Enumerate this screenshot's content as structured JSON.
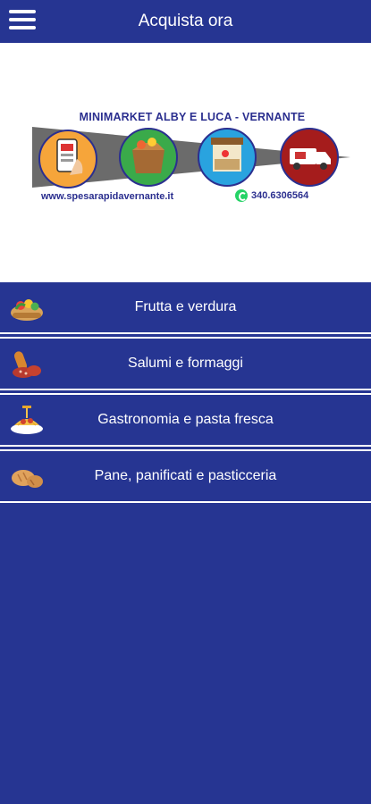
{
  "header": {
    "title": "Acquista ora",
    "menu_icon": "hamburger-menu-icon"
  },
  "banner": {
    "title": "MINIMARKET ALBY E LUCA - VERNANTE",
    "url": "www.spesarapidavernante.it",
    "phone": "340.6306564",
    "icons": [
      "phone-order-icon",
      "grocery-box-icon",
      "shop-counter-icon",
      "delivery-van-icon"
    ],
    "colors": {
      "orange": "#f6a53a",
      "green": "#3aaa4a",
      "blue": "#29a3df",
      "red": "#a51c1c",
      "text": "#2b2f8f"
    }
  },
  "categories": [
    {
      "label": "Frutta e verdura",
      "icon": "fruit-basket-icon"
    },
    {
      "label": "Salumi e formaggi",
      "icon": "salami-icon"
    },
    {
      "label": "Gastronomia e pasta fresca",
      "icon": "pasta-icon"
    },
    {
      "label": "Pane, panificati e pasticceria",
      "icon": "bread-icon"
    }
  ],
  "theme": {
    "primary": "#263592",
    "divider": "#ffffff"
  }
}
